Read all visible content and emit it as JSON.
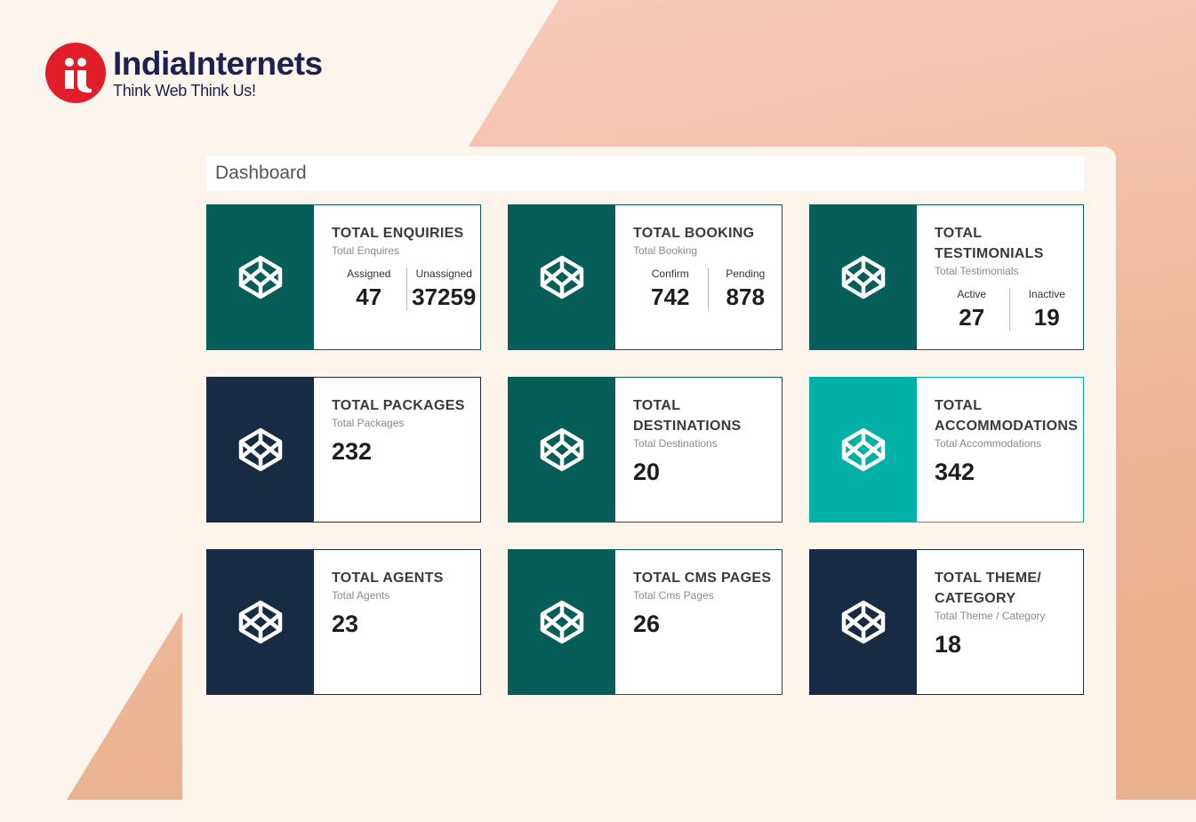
{
  "brand": {
    "name": "IndiaInternets",
    "tagline": "Think Web Think Us!",
    "logo_color": "#e11d2a",
    "text_color": "#1e2050"
  },
  "dashboard": {
    "title": "Dashboard"
  },
  "colors": {
    "teal_dark": "#075e59",
    "navy": "#182b44",
    "teal_bright": "#03b0a6"
  },
  "cards": [
    {
      "title": "TOTAL ENQUIRIES",
      "subtitle": "Total Enquires",
      "icon": "codepen-icon",
      "color": "#075e59",
      "stats": [
        {
          "label": "Assigned",
          "value": "47"
        },
        {
          "label": "Unassigned",
          "value": "37259"
        }
      ]
    },
    {
      "title": "TOTAL BOOKING",
      "subtitle": "Total Booking",
      "icon": "codepen-icon",
      "color": "#075e59",
      "stats": [
        {
          "label": "Confirm",
          "value": "742"
        },
        {
          "label": "Pending",
          "value": "878"
        }
      ]
    },
    {
      "title": "TOTAL TESTIMONIALS",
      "subtitle": "Total Testimonials",
      "icon": "codepen-icon",
      "color": "#075e59",
      "stats": [
        {
          "label": "Active",
          "value": "27"
        },
        {
          "label": "Inactive",
          "value": "19"
        }
      ]
    },
    {
      "title": "TOTAL PACKAGES",
      "subtitle": "Total Packages",
      "icon": "codepen-icon",
      "color": "#182b44",
      "value": "232"
    },
    {
      "title": "TOTAL DESTINATIONS",
      "subtitle": "Total Destinations",
      "icon": "codepen-icon",
      "color": "#075e59",
      "value": "20"
    },
    {
      "title": "TOTAL ACCOMMODATIONS",
      "subtitle": "Total Accommodations",
      "icon": "codepen-icon",
      "color": "#03b0a6",
      "value": "342"
    },
    {
      "title": "TOTAL AGENTS",
      "subtitle": "Total Agents",
      "icon": "codepen-icon",
      "color": "#182b44",
      "value": "23"
    },
    {
      "title": "TOTAL CMS PAGES",
      "subtitle": "Total Cms Pages",
      "icon": "codepen-icon",
      "color": "#075e59",
      "value": "26"
    },
    {
      "title": "TOTAL THEME/ CATEGORY",
      "subtitle": "Total Theme / Category",
      "icon": "codepen-icon",
      "color": "#182b44",
      "value": "18"
    }
  ]
}
